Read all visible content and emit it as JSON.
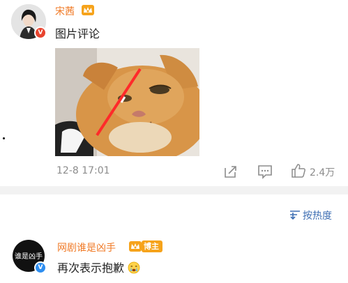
{
  "comment1": {
    "username": "宋茜",
    "text": "图片评论",
    "time": "12-8 17:01",
    "likes": "2.4万"
  },
  "sort": {
    "label": "按热度"
  },
  "comment2": {
    "username": "网剧谁是凶手",
    "badge": "博主",
    "text": "再次表示抱歉",
    "avatar_text": "谁是凶手"
  },
  "colors": {
    "username": "#f07a26",
    "link": "#3f6fb3",
    "meta": "#8c8c8c",
    "verified_red": "#e8442f",
    "verified_blue": "#2e8ef0",
    "badge_orange": "#f6a31b"
  }
}
